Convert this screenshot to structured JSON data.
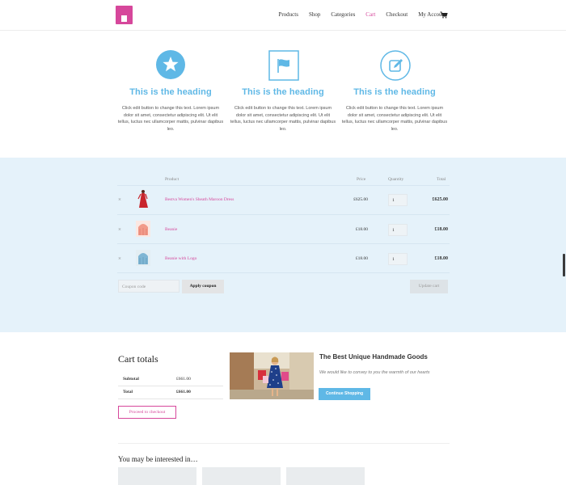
{
  "header": {
    "logo_alt": "ECOMMERCE ONLINE",
    "nav": [
      {
        "label": "Products",
        "active": false
      },
      {
        "label": "Shop",
        "active": false
      },
      {
        "label": "Categories",
        "active": false
      },
      {
        "label": "Cart",
        "active": true
      },
      {
        "label": "Checkout",
        "active": false
      },
      {
        "label": "My Account",
        "active": false
      }
    ],
    "cart_icon": "shopping-cart-icon"
  },
  "features": [
    {
      "icon": "star-icon",
      "heading": "This is the heading",
      "text": "Click edit button to change this text. Lorem ipsum dolor sit amet, consectetur adipiscing elit. Ut elit tellus, luctus nec ullamcorper mattis, pulvinar dapibus leo."
    },
    {
      "icon": "flag-icon",
      "heading": "This is the heading",
      "text": "Click edit button to change this text. Lorem ipsum dolor sit amet, consectetur adipiscing elit. Ut elit tellus, luctus nec ullamcorper mattis, pulvinar dapibus leo."
    },
    {
      "icon": "edit-icon",
      "heading": "This is the heading",
      "text": "Click edit button to change this text. Lorem ipsum dolor sit amet, consectetur adipiscing elit. Ut elit tellus, luctus nec ullamcorper mattis, pulvinar dapibus leo."
    }
  ],
  "cart_table": {
    "headers": {
      "product": "Product",
      "price": "Price",
      "quantity": "Quantity",
      "total": "Total"
    },
    "rows": [
      {
        "remove": "×",
        "name": "Bestva Women's Sheath Maroon Dress",
        "price": "£625.00",
        "qty": "1",
        "total": "£625.00"
      },
      {
        "remove": "×",
        "name": "Beanie",
        "price": "£18.00",
        "qty": "1",
        "total": "£18.00"
      },
      {
        "remove": "×",
        "name": "Beanie with Logo",
        "price": "£18.00",
        "qty": "1",
        "total": "£18.00"
      }
    ],
    "coupon_placeholder": "Coupon code",
    "apply_label": "Apply coupon",
    "update_label": "Update cart"
  },
  "cart_totals": {
    "title": "Cart totals",
    "subtotal_label": "Subtotal",
    "subtotal_value": "£661.00",
    "total_label": "Total",
    "total_value": "£661.00",
    "checkout_label": "Proceed to checkout"
  },
  "promo": {
    "title": "The Best Unique Handmade Goods",
    "text": "We would like to convey to you the warmth of our hearts",
    "button": "Continue Shopping"
  },
  "interested": {
    "title": "You may be interested in…"
  },
  "colors": {
    "accent": "#d6479b",
    "blue": "#5fb8e6",
    "band": "#e5f2fa"
  }
}
